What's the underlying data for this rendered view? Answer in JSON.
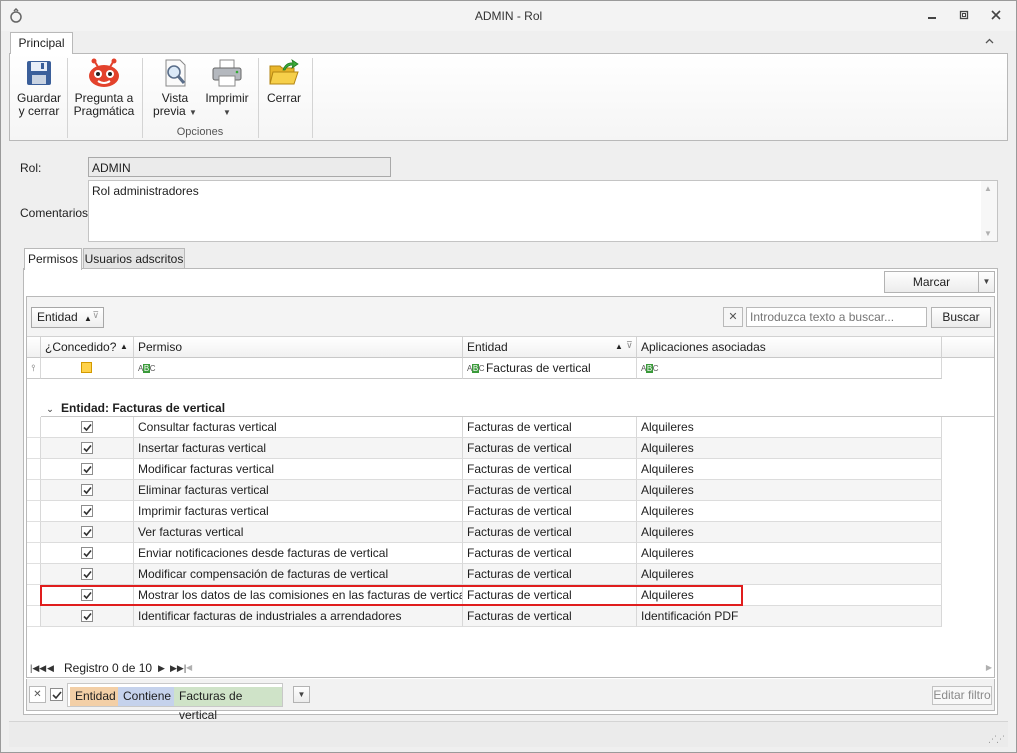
{
  "window": {
    "title": "ADMIN - Rol"
  },
  "ribbon": {
    "tab": "Principal",
    "buttons": {
      "save_close": "Guardar\ny cerrar",
      "pragmatica": "Pregunta a\nPragmática",
      "vista_previa": "Vista\nprevia",
      "imprimir": "Imprimir",
      "cerrar": "Cerrar"
    },
    "group_opciones": "Opciones"
  },
  "form": {
    "rol_label": "Rol:",
    "rol_value": "ADMIN",
    "comentarios_label": "Comentarios:",
    "comentarios_value": "Rol administradores"
  },
  "tabs": {
    "permisos": "Permisos",
    "usuarios": "Usuarios adscritos"
  },
  "toolbar": {
    "marcar": "Marcar"
  },
  "grid": {
    "group_by_chip": "Entidad",
    "search_placeholder": "Introduzca texto a buscar...",
    "search_button": "Buscar",
    "columns": {
      "concedido": "¿Concedido?",
      "permiso": "Permiso",
      "entidad": "Entidad",
      "aplicaciones": "Aplicaciones  asociadas"
    },
    "filter_row": {
      "entidad": "Facturas de vertical"
    },
    "group_label": "Entidad: Facturas de vertical",
    "rows": [
      {
        "permiso": "Consultar facturas vertical",
        "entidad": "Facturas de vertical",
        "aplicaciones": "Alquileres",
        "concedido": true
      },
      {
        "permiso": "Insertar facturas vertical",
        "entidad": "Facturas de vertical",
        "aplicaciones": "Alquileres",
        "concedido": true
      },
      {
        "permiso": "Modificar facturas vertical",
        "entidad": "Facturas de vertical",
        "aplicaciones": "Alquileres",
        "concedido": true
      },
      {
        "permiso": "Eliminar facturas vertical",
        "entidad": "Facturas de vertical",
        "aplicaciones": "Alquileres",
        "concedido": true
      },
      {
        "permiso": "Imprimir facturas vertical",
        "entidad": "Facturas de vertical",
        "aplicaciones": "Alquileres",
        "concedido": true
      },
      {
        "permiso": "Ver facturas vertical",
        "entidad": "Facturas de vertical",
        "aplicaciones": "Alquileres",
        "concedido": true
      },
      {
        "permiso": "Enviar notificaciones desde facturas de vertical",
        "entidad": "Facturas de vertical",
        "aplicaciones": "Alquileres",
        "concedido": true
      },
      {
        "permiso": "Modificar compensación de facturas de vertical",
        "entidad": "Facturas de vertical",
        "aplicaciones": "Alquileres",
        "concedido": true
      },
      {
        "permiso": "Mostrar los datos de las comisiones en las facturas de vertical",
        "entidad": "Facturas de vertical",
        "aplicaciones": "Alquileres",
        "concedido": true
      },
      {
        "permiso": "Identificar facturas de industriales a arrendadores",
        "entidad": "Facturas de vertical",
        "aplicaciones": "Identificación PDF",
        "concedido": true
      }
    ],
    "navigator": "Registro 0 de 10"
  },
  "filter_panel": {
    "tokens": [
      "Entidad",
      "Contiene",
      "Facturas de vertical"
    ],
    "token_colors": [
      "#f3cfa6",
      "#c5d2ec",
      "#cfe3c8"
    ],
    "edit_filter": "Editar filtro"
  }
}
